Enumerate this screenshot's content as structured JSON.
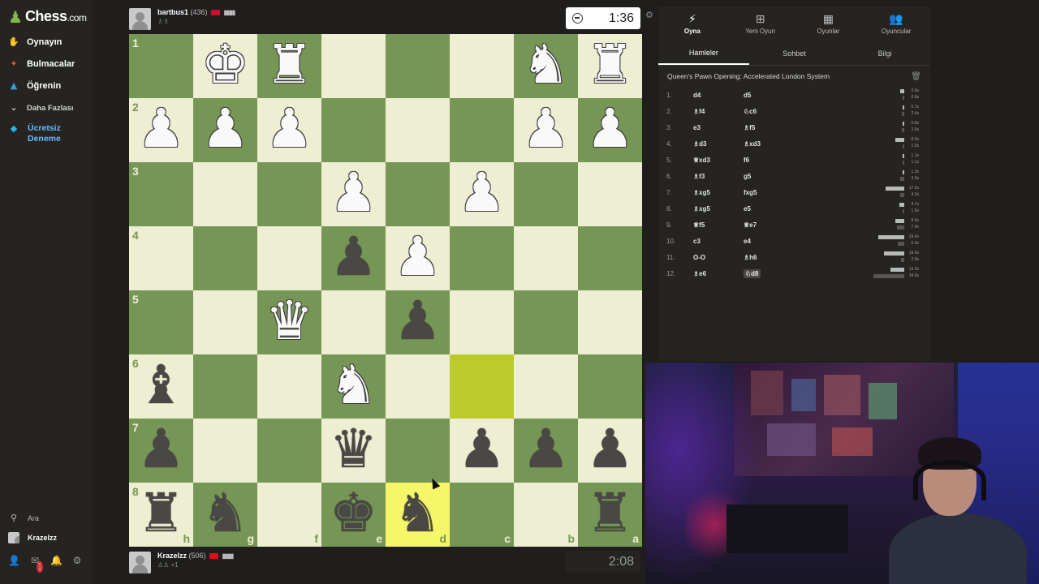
{
  "app": {
    "logo_text": "Chess",
    "logo_domain": ".com"
  },
  "nav": {
    "items": [
      {
        "label": "Oynayın",
        "icon": "play-icon",
        "glyph": "✋",
        "color": "#e0a030"
      },
      {
        "label": "Bulmacalar",
        "icon": "puzzle-icon",
        "glyph": "✦",
        "color": "#e05a2c"
      },
      {
        "label": "Öğrenin",
        "icon": "learn-icon",
        "glyph": "▲",
        "color": "#3a9ad8"
      },
      {
        "label": "Daha Fazlası",
        "icon": "chevron-down-icon",
        "glyph": "⌄",
        "color": "#cfcfcf"
      }
    ],
    "trial_line1": "Ücretsiz",
    "trial_line2": "Deneme",
    "search_label": "Ara",
    "user_label": "Krazelzz",
    "notification_count": "1"
  },
  "top_player": {
    "name": "bartbus1",
    "rating": "(436)",
    "flag_color": "#c8102e",
    "clock": "1:36"
  },
  "bottom_player": {
    "name": "Krazelzz",
    "rating": "(506)",
    "flag_color": "#e30a17",
    "sub": "+1",
    "clock": "2:08"
  },
  "board": {
    "orientation": "black",
    "ranks": [
      "1",
      "2",
      "3",
      "4",
      "5",
      "6",
      "7",
      "8"
    ],
    "files": [
      "h",
      "g",
      "f",
      "e",
      "d",
      "c",
      "b",
      "a"
    ],
    "highlights": [
      "c6",
      "d8"
    ],
    "pieces": {
      "g1": "wK",
      "f1": "wR",
      "b1": "wN",
      "a1": "wR",
      "h2": "wP",
      "g2": "wP",
      "f2": "wP",
      "b2": "wP",
      "a2": "wP",
      "e3": "wP",
      "c3": "wP",
      "e4": "bP",
      "d4": "wP",
      "f5": "wQ",
      "d5": "bP",
      "h6": "bB",
      "e6": "wN",
      "h7": "bP",
      "e7": "bQ",
      "c7": "bP",
      "b7": "bP",
      "a7": "bP",
      "h8": "bR",
      "g8": "bN",
      "e8": "bK",
      "d8": "bN",
      "a8": "bR"
    }
  },
  "panel": {
    "top_tabs": [
      {
        "label": "Oyna",
        "icon": "lightning-icon",
        "glyph": "⚡",
        "active": true
      },
      {
        "label": "Yeni Oyun",
        "icon": "plus-square-icon",
        "glyph": "⊞",
        "active": false
      },
      {
        "label": "Oyunlar",
        "icon": "board-icon",
        "glyph": "▦",
        "active": false
      },
      {
        "label": "Oyuncular",
        "icon": "players-icon",
        "glyph": "👥",
        "active": false
      }
    ],
    "sub_tabs": [
      {
        "label": "Hamleler",
        "active": true
      },
      {
        "label": "Sohbet",
        "active": false
      },
      {
        "label": "Bilgi",
        "active": false
      }
    ],
    "opening": "Queen's Pawn Opening: Accelerated London System",
    "moves": [
      {
        "num": "1.",
        "white": "d4",
        "black": "d5",
        "wt": "3.6s",
        "bt": "0.8s",
        "wbar": 0.12,
        "bbar": 0.03
      },
      {
        "num": "2.",
        "white": "♗f4",
        "black": "♘c6",
        "wt": "0.7s",
        "bt": "2.4s",
        "wbar": 0.03,
        "bbar": 0.08
      },
      {
        "num": "3.",
        "white": "e3",
        "black": "♗f5",
        "wt": "0.8s",
        "bt": "2.6s",
        "wbar": 0.03,
        "bbar": 0.09
      },
      {
        "num": "4.",
        "white": "♗d3",
        "black": "♗xd3",
        "wt": "8.5s",
        "bt": "1.0s",
        "wbar": 0.29,
        "bbar": 0.04
      },
      {
        "num": "5.",
        "white": "♕xd3",
        "black": "f6",
        "wt": "1.1s",
        "bt": "1.1s",
        "wbar": 0.04,
        "bbar": 0.04
      },
      {
        "num": "6.",
        "white": "♗f3",
        "black": "g5",
        "wt": "1.3s",
        "bt": "3.9s",
        "wbar": 0.05,
        "bbar": 0.13
      },
      {
        "num": "7.",
        "white": "♗xg5",
        "black": "fxg5",
        "wt": "17.5s",
        "bt": "4.2s",
        "wbar": 0.6,
        "bbar": 0.14
      },
      {
        "num": "8.",
        "white": "♗xg5",
        "black": "e5",
        "wt": "4.7s",
        "bt": "1.6s",
        "wbar": 0.16,
        "bbar": 0.06
      },
      {
        "num": "9.",
        "white": "♕f5",
        "black": "♕e7",
        "wt": "8.6s",
        "bt": "7.4s",
        "wbar": 0.29,
        "bbar": 0.25
      },
      {
        "num": "10.",
        "white": "c3",
        "black": "e4",
        "wt": "24.6s",
        "bt": "6.3s",
        "wbar": 0.84,
        "bbar": 0.22
      },
      {
        "num": "11.",
        "white": "O-O",
        "black": "♗h6",
        "wt": "19.0s",
        "bt": "2.9s",
        "wbar": 0.65,
        "bbar": 0.1
      },
      {
        "num": "12.",
        "white": "♗e6",
        "black": "♘d8",
        "wt": "13.3s",
        "bt": "34.6s",
        "wbar": 0.45,
        "bbar": 1.0
      }
    ]
  }
}
